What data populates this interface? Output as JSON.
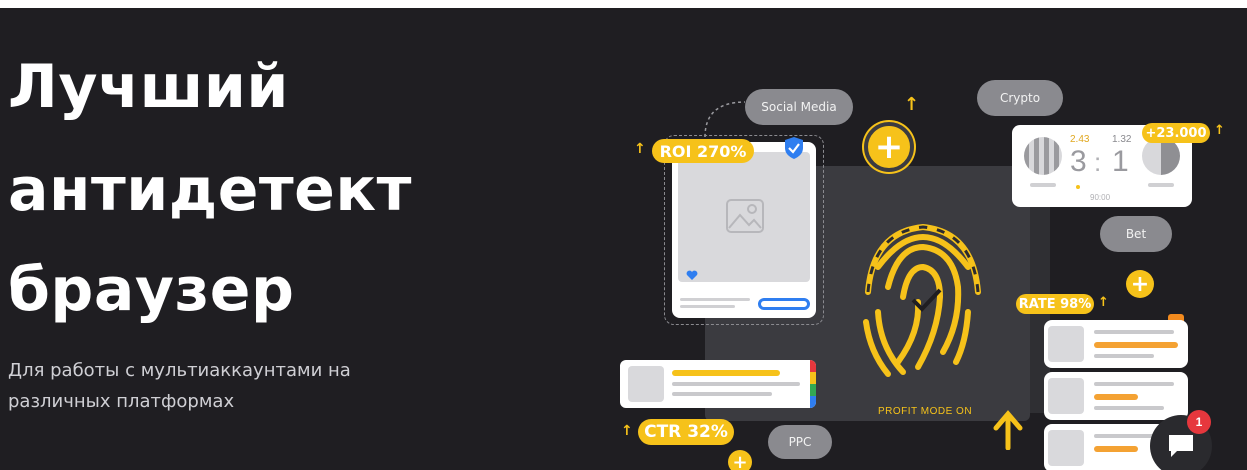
{
  "hero": {
    "title_lines": [
      "Лучший",
      "антидетект",
      "браузер"
    ],
    "subtitle_line1": "Для работы с мультиаккаунтами на",
    "subtitle_line2": "различных платформах"
  },
  "illustration": {
    "tags": {
      "social_media": "Social Media",
      "crypto": "Crypto",
      "bet": "Bet",
      "ppc": "PPC"
    },
    "badges": {
      "roi": "ROI 270%",
      "ctr": "CTR 32%",
      "rate": "RATE 98%",
      "score_bonus": "+23.000"
    },
    "scoreboard": {
      "odds_left": "2.43",
      "odds_right": "1.32",
      "score_left": "3",
      "separator": ":",
      "score_right": "1",
      "time": "90:00"
    },
    "fingerprint_caption": "PROFIT MODE ON",
    "arrow_glyph": "↑",
    "plus_glyph": "+"
  },
  "chat": {
    "unread_count": "1"
  },
  "colors": {
    "background": "#1f1e22",
    "accent_yellow": "#f6c21a",
    "tag_gray": "#8a8a8f",
    "notification_red": "#e6373d"
  }
}
